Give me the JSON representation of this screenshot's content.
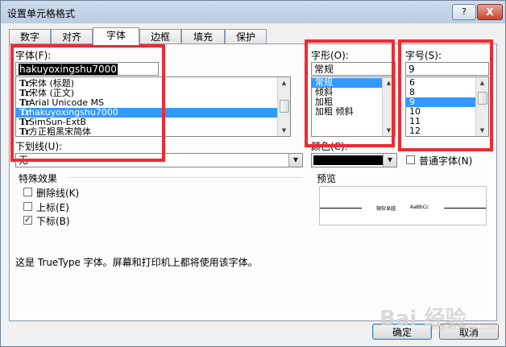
{
  "window": {
    "title": "设置单元格格式",
    "help_glyph": "?",
    "close_glyph": "X"
  },
  "tabs": [
    "数字",
    "对齐",
    "字体",
    "边框",
    "填充",
    "保护"
  ],
  "font": {
    "label": "字体(F):",
    "value": "hakuyoxingshu7000",
    "items": [
      {
        "icon": "Tr",
        "label": "宋体 (标题)"
      },
      {
        "icon": "Tr",
        "label": "宋体 (正文)"
      },
      {
        "icon": "Tr",
        "label": "Arial Unicode MS"
      },
      {
        "icon": "Tr",
        "label": "hakuyoxingshu7000"
      },
      {
        "icon": "Tr",
        "label": "SimSun-ExtB"
      },
      {
        "icon": "Tr",
        "label": "方正粗黑宋简体"
      }
    ]
  },
  "style": {
    "label": "字形(O):",
    "value": "常规",
    "items": [
      "常规",
      "倾斜",
      "加粗",
      "加粗 倾斜"
    ]
  },
  "size": {
    "label": "字号(S):",
    "value": "9",
    "items": [
      "6",
      "8",
      "9",
      "10",
      "11",
      "12"
    ]
  },
  "underline": {
    "label": "下划线(U):",
    "value": "无"
  },
  "color": {
    "label": "颜色(C):",
    "swatch": "#000000"
  },
  "normal_font": {
    "label": "普通字体(N)",
    "checked": false
  },
  "effects": {
    "title": "特殊效果",
    "items": [
      {
        "label": "删除线(K)",
        "checked": false
      },
      {
        "label": "上标(E)",
        "checked": false
      },
      {
        "label": "下标(B)",
        "checked": true
      }
    ]
  },
  "preview": {
    "title": "预览",
    "sample_left": "微软卓越",
    "sample_right": "AaBbCc"
  },
  "info": "这是 TrueType 字体。屏幕和打印机上都将使用该字体。",
  "buttons": {
    "ok": "确定",
    "cancel": "取消"
  },
  "watermark": {
    "main": "Bai 经验",
    "sub": "jingyan.baidu.com"
  },
  "colors": {
    "highlight": "#3399ff",
    "annotation": "#ee2a33"
  }
}
